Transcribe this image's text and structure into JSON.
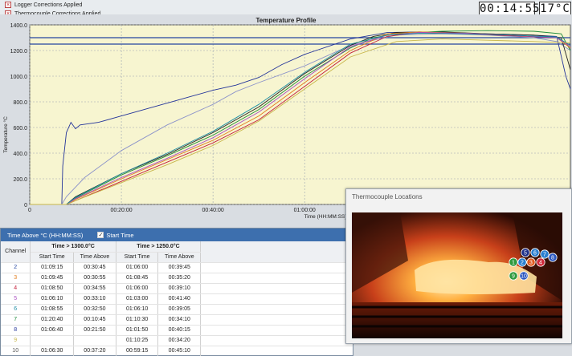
{
  "checks": {
    "logger": "Logger Corrections Applied",
    "thermocouple": "Thermocouple Corrections Applied",
    "mark": "×"
  },
  "clock": "00:14:55",
  "ambient": "17°C",
  "chart_data": {
    "type": "line",
    "title": "Temperature Profile",
    "ylabel": "Temperature °C",
    "xlabel": "Time (HH:MM:SS)",
    "y_ticks": [
      "0",
      "200.0",
      "400.0",
      "600.0",
      "800.0",
      "1000.0",
      "1200.0",
      "1400.0"
    ],
    "x_ticks": [
      "0",
      "00:20:00",
      "00:40:00",
      "01:00:00"
    ],
    "ylim": [
      0,
      1400
    ],
    "x_unit": "minutes",
    "xlim": [
      0,
      118
    ],
    "thresholds": [
      1300,
      1250
    ],
    "threshold_color": "#2446a0",
    "plot_bg": "#f7f5d0",
    "series": [
      {
        "color": "#24349a",
        "x": [
          0,
          7,
          7.2,
          8,
          9,
          10,
          11,
          15,
          20,
          25,
          30,
          35,
          40,
          45,
          50,
          55,
          60,
          70,
          78,
          85,
          90,
          100,
          110,
          115,
          117,
          118
        ],
        "values": [
          0,
          0,
          300,
          560,
          640,
          590,
          620,
          640,
          690,
          740,
          790,
          840,
          890,
          930,
          990,
          1090,
          1170,
          1290,
          1340,
          1345,
          1340,
          1330,
          1320,
          1310,
          1000,
          900
        ]
      },
      {
        "color": "#8c93c9",
        "x": [
          0,
          7,
          8,
          12,
          20,
          30,
          40,
          45,
          50,
          60,
          70,
          80,
          90,
          100,
          110,
          115,
          118
        ],
        "values": [
          0,
          0,
          60,
          210,
          420,
          620,
          780,
          880,
          950,
          1080,
          1240,
          1320,
          1330,
          1320,
          1300,
          1270,
          1200
        ]
      },
      {
        "color": "#222222",
        "x": [
          0,
          8,
          10,
          20,
          30,
          40,
          50,
          60,
          70,
          75,
          80,
          90,
          100,
          110,
          116,
          118
        ],
        "values": [
          0,
          0,
          60,
          240,
          390,
          560,
          760,
          1020,
          1240,
          1310,
          1340,
          1345,
          1330,
          1320,
          1300,
          1050
        ]
      },
      {
        "color": "#1d8a3a",
        "x": [
          0,
          8,
          10,
          20,
          30,
          40,
          50,
          60,
          70,
          75,
          80,
          90,
          100,
          110,
          116,
          118
        ],
        "values": [
          0,
          0,
          50,
          230,
          380,
          540,
          740,
          1000,
          1220,
          1300,
          1330,
          1350,
          1355,
          1350,
          1330,
          1200
        ]
      },
      {
        "color": "#e07b1a",
        "x": [
          0,
          8,
          10,
          20,
          30,
          40,
          50,
          60,
          70,
          78,
          85,
          95,
          105,
          115,
          118
        ],
        "values": [
          0,
          0,
          40,
          200,
          350,
          500,
          690,
          950,
          1200,
          1330,
          1345,
          1335,
          1320,
          1300,
          1220
        ]
      },
      {
        "color": "#c41f3a",
        "x": [
          0,
          8,
          10,
          20,
          30,
          40,
          50,
          60,
          70,
          78,
          85,
          95,
          105,
          115,
          118
        ],
        "values": [
          0,
          0,
          30,
          180,
          330,
          480,
          660,
          920,
          1180,
          1310,
          1340,
          1330,
          1315,
          1300,
          1240
        ]
      },
      {
        "color": "#a94fc0",
        "x": [
          0,
          8,
          10,
          20,
          30,
          40,
          50,
          60,
          70,
          78,
          85,
          95,
          105,
          115,
          118
        ],
        "values": [
          0,
          0,
          45,
          210,
          360,
          520,
          720,
          980,
          1230,
          1320,
          1340,
          1335,
          1320,
          1300,
          1230
        ]
      },
      {
        "color": "#1f8fa5",
        "x": [
          0,
          8,
          10,
          20,
          30,
          40,
          50,
          60,
          70,
          78,
          85,
          95,
          105,
          115,
          118
        ],
        "values": [
          0,
          0,
          55,
          240,
          400,
          570,
          780,
          1030,
          1250,
          1320,
          1335,
          1330,
          1320,
          1305,
          1240
        ]
      },
      {
        "color": "#c8b64a",
        "x": [
          0,
          8,
          10,
          20,
          30,
          40,
          50,
          60,
          70,
          80,
          90,
          100,
          110,
          118
        ],
        "values": [
          0,
          0,
          30,
          170,
          310,
          460,
          650,
          900,
          1150,
          1270,
          1290,
          1280,
          1270,
          1260
        ]
      }
    ]
  },
  "table": {
    "title": "Time Above °C (HH:MM:SS)",
    "start_time_label": "Start Time",
    "start_time_checked": "✓",
    "col_channel": "Channel",
    "group1": "Time > 1300.0°C",
    "group2": "Time > 1250.0°C",
    "sub_start": "Start Time",
    "sub_above": "Time Above",
    "rows": [
      {
        "ch": "2",
        "color": "#2446a0",
        "s1": "01:09:15",
        "a1": "00:30:45",
        "s2": "01:06:00",
        "a2": "00:39:45"
      },
      {
        "ch": "3",
        "color": "#e07b1a",
        "s1": "01:09:45",
        "a1": "00:30:55",
        "s2": "01:08:45",
        "a2": "00:35:20"
      },
      {
        "ch": "4",
        "color": "#c41f3a",
        "s1": "01:08:50",
        "a1": "00:34:55",
        "s2": "01:06:00",
        "a2": "00:39:10"
      },
      {
        "ch": "5",
        "color": "#a94fc0",
        "s1": "01:06:10",
        "a1": "00:33:10",
        "s2": "01:03:00",
        "a2": "00:41:40"
      },
      {
        "ch": "6",
        "color": "#1f8fa5",
        "s1": "01:08:55",
        "a1": "00:32:50",
        "s2": "01:06:10",
        "a2": "00:39:05"
      },
      {
        "ch": "7",
        "color": "#1d8a3a",
        "s1": "01:20:40",
        "a1": "00:10:45",
        "s2": "01:10:30",
        "a2": "00:34:10"
      },
      {
        "ch": "8",
        "color": "#24349a",
        "s1": "01:06:40",
        "a1": "00:21:50",
        "s2": "01:01:50",
        "a2": "00:40:15"
      },
      {
        "ch": "9",
        "color": "#c8b64a",
        "s1": "",
        "a1": "",
        "s2": "01:10:25",
        "a2": "00:34:20"
      },
      {
        "ch": "10",
        "color": "#555555",
        "s1": "01:06:30",
        "a1": "00:37:20",
        "s2": "00:59:15",
        "a2": "00:45:10"
      }
    ]
  },
  "popup": {
    "title": "Thermocouple Locations",
    "markers": [
      {
        "n": "1",
        "color": "#2e9a3e"
      },
      {
        "n": "2",
        "color": "#2a7fd0"
      },
      {
        "n": "3",
        "color": "#e05a20"
      },
      {
        "n": "4",
        "color": "#d02a3a"
      },
      {
        "n": "5",
        "color": "#1d2f8a"
      },
      {
        "n": "6",
        "color": "#2a7fd0"
      },
      {
        "n": "7",
        "color": "#2a7fd0"
      },
      {
        "n": "8",
        "color": "#2a57c0"
      },
      {
        "n": "9",
        "color": "#2e9a3e"
      },
      {
        "n": "10",
        "color": "#2a57c0"
      }
    ]
  }
}
